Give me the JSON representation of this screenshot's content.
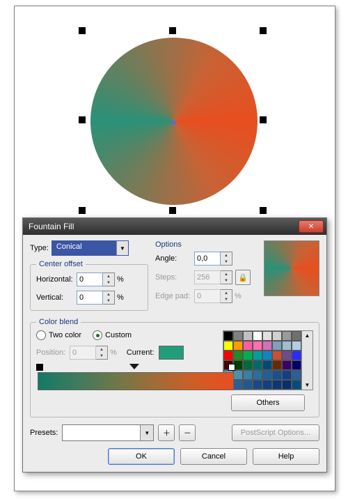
{
  "dialog": {
    "title": "Fountain Fill",
    "type_label": "Type:",
    "type_value": "Conical",
    "center_offset_title": "Center offset",
    "horizontal_label": "Horizontal:",
    "horizontal_value": "0",
    "vertical_label": "Vertical:",
    "vertical_value": "0",
    "percent": "%",
    "options_title": "Options",
    "angle_label": "Angle:",
    "angle_value": "0,0",
    "steps_label": "Steps:",
    "steps_value": "256",
    "edgepad_label": "Edge pad:",
    "edgepad_value": "0",
    "color_blend_title": "Color blend",
    "two_color_label": "Two color",
    "custom_label": "Custom",
    "position_label": "Position:",
    "position_value": "0",
    "current_label": "Current:",
    "others_label": "Others",
    "presets_label": "Presets:",
    "postscript_label": "PostScript Options...",
    "ok_label": "OK",
    "cancel_label": "Cancel",
    "help_label": "Help"
  },
  "palette_colors": [
    "#000000",
    "#808080",
    "#c0c0c0",
    "#ffffff",
    "#e0e0e0",
    "#d0d0d0",
    "#9a9a9a",
    "#707070",
    "#ffff00",
    "#ff9a00",
    "#ff5e9b",
    "#ff6fae",
    "#d56fb8",
    "#7f9fbf",
    "#9fbfcf",
    "#b0cfe0",
    "#ff0000",
    "#228b22",
    "#00b050",
    "#009e9e",
    "#1084c8",
    "#cc5030",
    "#704a8c",
    "#2b2bff",
    "#400000",
    "#004000",
    "#006a3a",
    "#006a6a",
    "#004a7a",
    "#6a2a00",
    "#3a006a",
    "#00006a",
    "#5aa0b8",
    "#4a90b0",
    "#3880a8",
    "#2870a0",
    "#206098",
    "#185090",
    "#104088",
    "#2a609a",
    "#407094",
    "#286098",
    "#205890",
    "#184888",
    "#104080",
    "#083878",
    "#083070",
    "#004f7a"
  ],
  "gradient": {
    "start_color": "#127a65",
    "end_color": "#e84e1f",
    "current_color": "#209e7a"
  }
}
